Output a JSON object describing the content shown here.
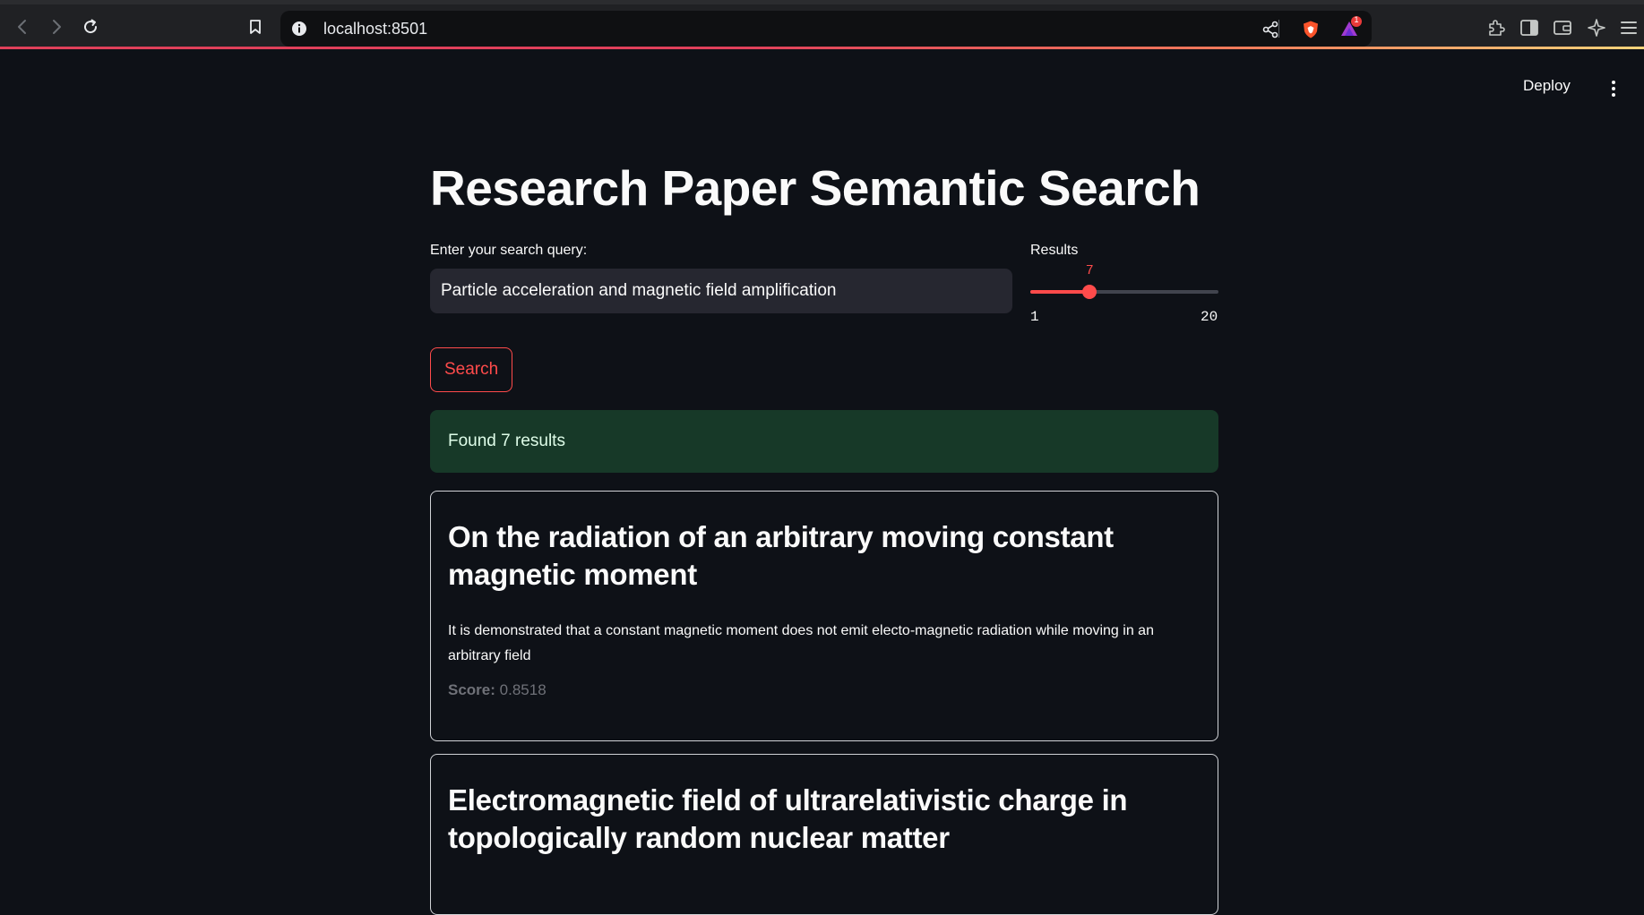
{
  "browser": {
    "url": "localhost:8501",
    "notification_count": "1"
  },
  "header": {
    "deploy_label": "Deploy"
  },
  "page": {
    "title": "Research Paper Semantic Search",
    "query_label": "Enter your search query:",
    "query_value": "Particle acceleration and magnetic field amplification",
    "results_label": "Results",
    "slider": {
      "value": "7",
      "min": "1",
      "max": "20"
    },
    "search_button": "Search",
    "success_message": "Found 7 results"
  },
  "results": [
    {
      "title": "On the radiation of an arbitrary moving constant magnetic moment",
      "abstract": "It is demonstrated that a constant magnetic moment does not emit electo-magnetic radiation while moving in an arbitrary field",
      "score_label": "Score:",
      "score_value": "0.8518"
    },
    {
      "title": "Electromagnetic field of ultrarelativistic charge in topologically random nuclear matter",
      "abstract": "",
      "score_label": "",
      "score_value": ""
    }
  ],
  "colors": {
    "background": "#0e1117",
    "primary": "#ff4b4b",
    "input_bg": "#262730",
    "success_bg": "#173928"
  },
  "icons": [
    "back-icon",
    "forward-icon",
    "reload-icon",
    "bookmark-icon",
    "info-icon",
    "share-icon",
    "brave-shield-icon",
    "brave-rewards-icon",
    "extensions-icon",
    "sidebar-icon",
    "wallet-icon",
    "leo-ai-icon",
    "menu-icon",
    "kebab-menu-icon"
  ]
}
